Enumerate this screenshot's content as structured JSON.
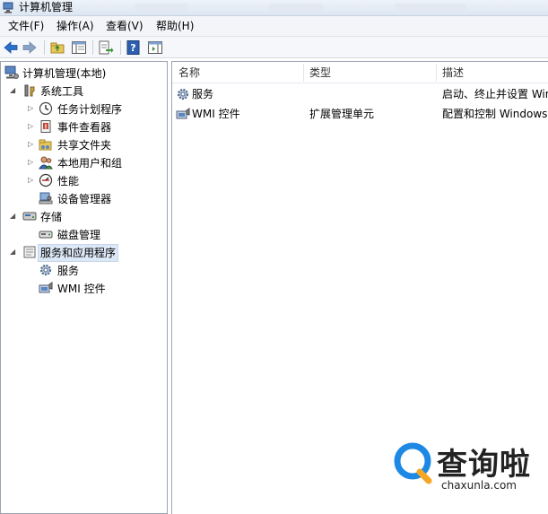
{
  "window": {
    "title": "计算机管理"
  },
  "menu": [
    "文件(F)",
    "操作(A)",
    "查看(V)",
    "帮助(H)"
  ],
  "tree": {
    "root": "计算机管理(本地)",
    "system_tools": "系统工具",
    "task_scheduler": "任务计划程序",
    "event_viewer": "事件查看器",
    "shared_folders": "共享文件夹",
    "local_users": "本地用户和组",
    "performance": "性能",
    "device_manager": "设备管理器",
    "storage": "存储",
    "disk_management": "磁盘管理",
    "services_apps": "服务和应用程序",
    "services": "服务",
    "wmi": "WMI 控件"
  },
  "table": {
    "headers": [
      "名称",
      "类型",
      "描述"
    ],
    "rows": [
      {
        "name": "服务",
        "type": "",
        "desc": "启动、终止并设置 Win"
      },
      {
        "name": "WMI 控件",
        "type": "扩展管理单元",
        "desc": "配置和控制 Windows"
      }
    ]
  },
  "watermark": {
    "brand": "查询啦",
    "domain": "chaxunla.com"
  },
  "colors": {
    "selection": "#dce8f6",
    "toolbar_blue": "#2a6fc9",
    "watermark_blue": "#1e88e5"
  }
}
